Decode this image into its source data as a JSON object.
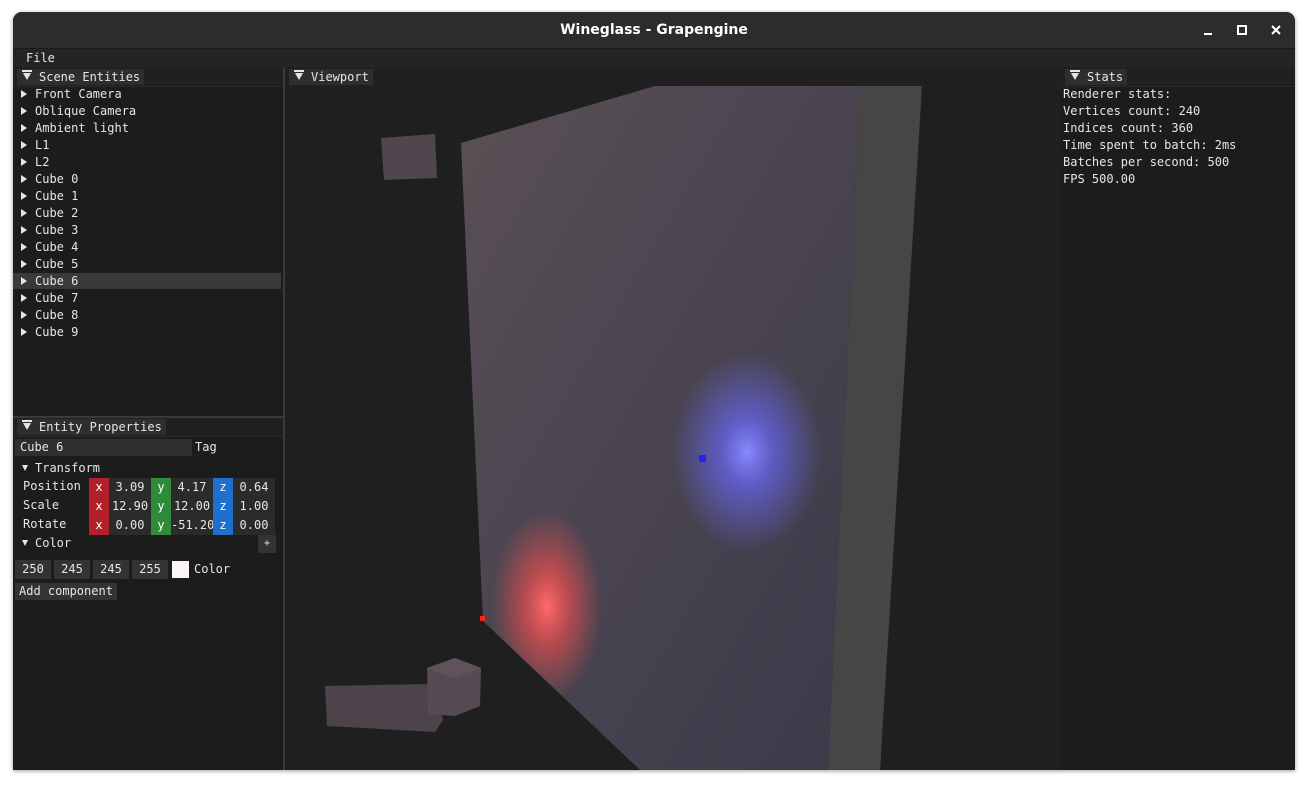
{
  "window": {
    "title": "Wineglass - Grapengine"
  },
  "menubar": {
    "file": "File"
  },
  "scene_panel": {
    "title": "Scene Entities",
    "items": [
      "Front Camera",
      "Oblique Camera",
      "Ambient light",
      "L1",
      "L2",
      "Cube 0",
      "Cube 1",
      "Cube 2",
      "Cube 3",
      "Cube 4",
      "Cube 5",
      "Cube 6",
      "Cube 7",
      "Cube 8",
      "Cube 9"
    ],
    "selected": "Cube 6"
  },
  "properties_panel": {
    "title": "Entity Properties",
    "tag_value": "Cube 6",
    "tag_label": "Tag",
    "transform_label": "Transform",
    "position_label": "Position",
    "scale_label": "Scale",
    "rotate_label": "Rotate",
    "axis_x": "x",
    "axis_y": "y",
    "axis_z": "z",
    "position": {
      "x": "3.09",
      "y": "4.17",
      "z": "0.64"
    },
    "scale": {
      "x": "12.90",
      "y": "12.00",
      "z": "1.00"
    },
    "rotate": {
      "x": "0.00",
      "y": "-51.20",
      "z": "0.00"
    },
    "color_section_label": "Color",
    "color_add": "+",
    "color_values": [
      "250",
      "245",
      "245",
      "255"
    ],
    "color_label": "Color",
    "color_swatch": "#faf5f5",
    "add_component": "Add component"
  },
  "viewport_panel": {
    "title": "Viewport"
  },
  "stats_panel": {
    "title": "Stats",
    "lines": [
      "Renderer stats:",
      "Vertices count: 240",
      "Indices count: 360",
      "Time spent to batch: 2ms",
      "Batches per second: 500",
      "FPS 500.00"
    ]
  },
  "colors": {
    "axis_x": "#b3202a",
    "axis_y": "#2f8b38",
    "axis_z": "#1f6fcf",
    "light_blue": "#6a6aff",
    "light_red": "#ff5050"
  }
}
